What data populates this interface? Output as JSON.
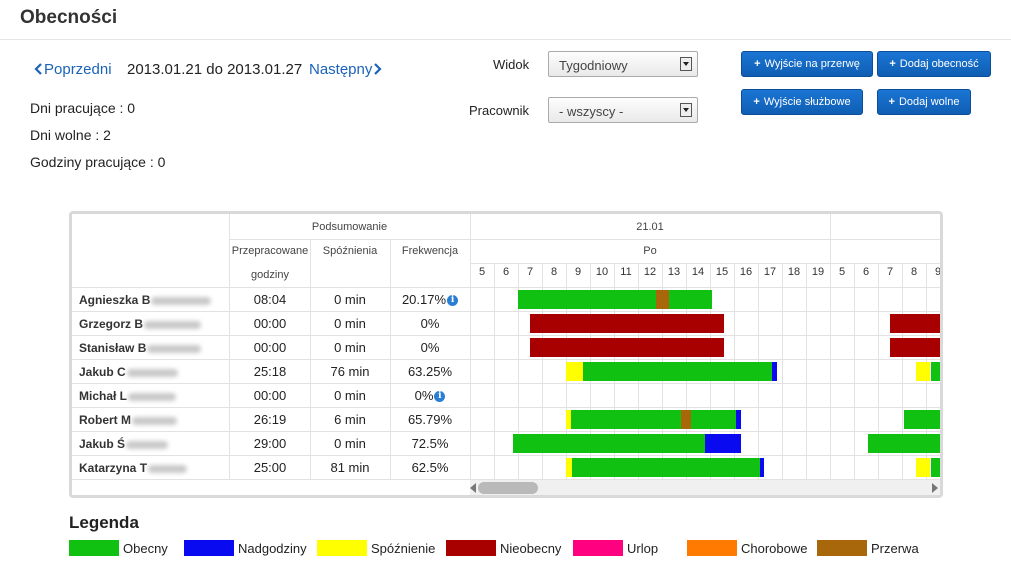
{
  "page": {
    "title": "Obecności"
  },
  "nav": {
    "prev_label": "Poprzedni",
    "next_label": "Następny",
    "date_range": "2013.01.21 do 2013.01.27"
  },
  "stats": {
    "work_days": "Dni pracujące : 0",
    "free_days": "Dni wolne : 2",
    "work_hours": "Godziny pracujące : 0"
  },
  "filters": {
    "view_label": "Widok",
    "view_value": "Tygodniowy",
    "employee_label": "Pracownik",
    "employee_value": "- wszyscy -"
  },
  "buttons": {
    "break_exit": "Wyjście na przerwę",
    "add_presence": "Dodaj obecność",
    "business_exit": "Wyjście służbowe",
    "add_free": "Dodaj wolne"
  },
  "table": {
    "summary_header": "Podsumowanie",
    "col_worked_1": "Przepracowane",
    "col_worked_2": "godziny",
    "col_late": "Spóźnienia",
    "col_attendance": "Frekwencja",
    "day1_date": "21.01",
    "day1_name": "Po",
    "hours_day1": [
      "5",
      "6",
      "7",
      "8",
      "9",
      "10",
      "11",
      "12",
      "13",
      "14",
      "15",
      "16",
      "17",
      "18",
      "19"
    ],
    "hours_day2": [
      "5",
      "6",
      "7",
      "8",
      "9"
    ],
    "rows": [
      {
        "name": "Agnieszka B",
        "worked": "08:04",
        "late": "0 min",
        "attendance": "20.17%",
        "info": true
      },
      {
        "name": "Grzegorz B",
        "worked": "00:00",
        "late": "0 min",
        "attendance": "0%",
        "info": false
      },
      {
        "name": "Stanisław B",
        "worked": "00:00",
        "late": "0 min",
        "attendance": "0%",
        "info": false
      },
      {
        "name": "Jakub C",
        "worked": "25:18",
        "late": "76 min",
        "attendance": "63.25%",
        "info": false
      },
      {
        "name": "Michał L",
        "worked": "00:00",
        "late": "0 min",
        "attendance": "0%",
        "info": true
      },
      {
        "name": "Robert M",
        "worked": "26:19",
        "late": "6 min",
        "attendance": "65.79%",
        "info": false
      },
      {
        "name": "Jakub Ś",
        "worked": "29:00",
        "late": "0 min",
        "attendance": "72.5%",
        "info": false
      },
      {
        "name": "Katarzyna T",
        "worked": "25:00",
        "late": "81 min",
        "attendance": "62.5%",
        "info": false
      }
    ]
  },
  "timeline": {
    "hour_start": 5,
    "rows": [
      {
        "segments": [
          {
            "day": 0,
            "start": 7.0,
            "end": 12.75,
            "status": "present"
          },
          {
            "day": 0,
            "start": 12.75,
            "end": 13.3,
            "status": "break"
          },
          {
            "day": 0,
            "start": 13.3,
            "end": 15.1,
            "status": "present"
          }
        ]
      },
      {
        "segments": [
          {
            "day": 0,
            "start": 7.5,
            "end": 15.6,
            "status": "absent"
          },
          {
            "day": 1,
            "start": 7.5,
            "end": 10.0,
            "status": "absent"
          }
        ]
      },
      {
        "segments": [
          {
            "day": 0,
            "start": 7.5,
            "end": 15.6,
            "status": "absent"
          },
          {
            "day": 1,
            "start": 7.5,
            "end": 10.0,
            "status": "absent"
          }
        ]
      },
      {
        "segments": [
          {
            "day": 0,
            "start": 9.0,
            "end": 9.7,
            "status": "late"
          },
          {
            "day": 0,
            "start": 9.7,
            "end": 17.6,
            "status": "present"
          },
          {
            "day": 0,
            "start": 17.6,
            "end": 17.8,
            "status": "overtime"
          },
          {
            "day": 1,
            "start": 8.6,
            "end": 9.2,
            "status": "late"
          },
          {
            "day": 1,
            "start": 9.2,
            "end": 10.0,
            "status": "present"
          }
        ]
      },
      {
        "segments": []
      },
      {
        "segments": [
          {
            "day": 0,
            "start": 9.0,
            "end": 9.2,
            "status": "late"
          },
          {
            "day": 0,
            "start": 9.2,
            "end": 13.8,
            "status": "present"
          },
          {
            "day": 0,
            "start": 13.8,
            "end": 14.2,
            "status": "break"
          },
          {
            "day": 0,
            "start": 14.2,
            "end": 16.1,
            "status": "present"
          },
          {
            "day": 0,
            "start": 16.1,
            "end": 16.3,
            "status": "overtime"
          },
          {
            "day": 1,
            "start": 8.1,
            "end": 10.0,
            "status": "present"
          }
        ]
      },
      {
        "segments": [
          {
            "day": 0,
            "start": 6.8,
            "end": 14.8,
            "status": "present"
          },
          {
            "day": 0,
            "start": 14.8,
            "end": 16.3,
            "status": "overtime"
          },
          {
            "day": 1,
            "start": 6.6,
            "end": 10.0,
            "status": "present"
          }
        ]
      },
      {
        "segments": [
          {
            "day": 0,
            "start": 9.0,
            "end": 9.25,
            "status": "late"
          },
          {
            "day": 0,
            "start": 9.25,
            "end": 17.1,
            "status": "present"
          },
          {
            "day": 0,
            "start": 17.1,
            "end": 17.25,
            "status": "overtime"
          },
          {
            "day": 1,
            "start": 8.6,
            "end": 9.2,
            "status": "late"
          },
          {
            "day": 1,
            "start": 9.2,
            "end": 10.0,
            "status": "present"
          }
        ]
      }
    ]
  },
  "colors": {
    "present": "#11c111",
    "overtime": "#0a0af0",
    "late": "#ffff00",
    "absent": "#a80000",
    "leave": "#ff0080",
    "sick": "#ff7a00",
    "break": "#a8670b"
  },
  "legend": {
    "title": "Legenda",
    "items": [
      {
        "key": "present",
        "label": "Obecny"
      },
      {
        "key": "overtime",
        "label": "Nadgodziny"
      },
      {
        "key": "late",
        "label": "Spóźnienie"
      },
      {
        "key": "absent",
        "label": "Nieobecny"
      },
      {
        "key": "leave",
        "label": "Urlop"
      },
      {
        "key": "sick",
        "label": "Chorobowe"
      },
      {
        "key": "break",
        "label": "Przerwa"
      }
    ]
  }
}
